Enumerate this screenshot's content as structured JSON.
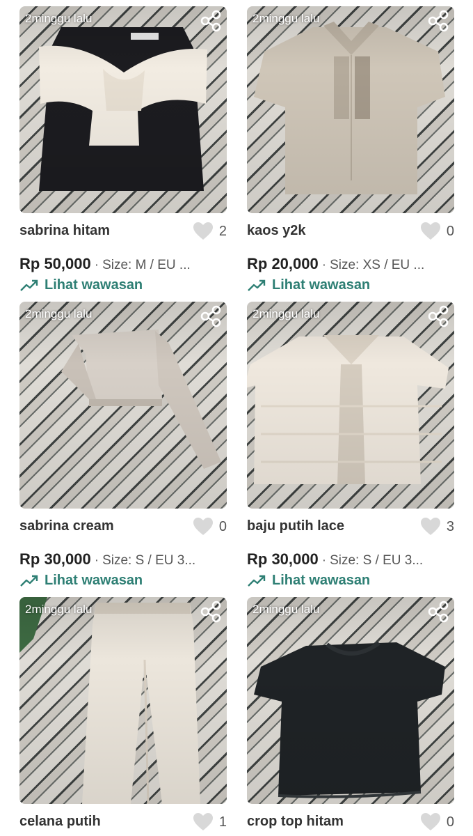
{
  "colors": {
    "insight": "#2e7f74",
    "title": "#333333",
    "heart": "#d8d8d8"
  },
  "products": [
    {
      "posted": "2minggu lalu",
      "title": "sabrina hitam",
      "likes": "2",
      "price": "Rp 50,000",
      "size": "Size: M / EU ...",
      "insight_label": "Lihat wawasan",
      "icons": [
        "share-icon",
        "heart-icon",
        "trend-up-icon"
      ]
    },
    {
      "posted": "2minggu lalu",
      "title": "kaos y2k",
      "likes": "0",
      "price": "Rp 20,000",
      "size": "Size: XS / EU ...",
      "insight_label": "Lihat wawasan",
      "icons": [
        "share-icon",
        "heart-icon",
        "trend-up-icon"
      ]
    },
    {
      "posted": "2minggu lalu",
      "title": "sabrina cream",
      "likes": "0",
      "price": "Rp 30,000",
      "size": "Size: S / EU 3...",
      "insight_label": "Lihat wawasan",
      "icons": [
        "share-icon",
        "heart-icon",
        "trend-up-icon"
      ]
    },
    {
      "posted": "2minggu lalu",
      "title": "baju putih lace",
      "likes": "3",
      "price": "Rp 30,000",
      "size": "Size: S / EU 3...",
      "insight_label": "Lihat wawasan",
      "icons": [
        "share-icon",
        "heart-icon",
        "trend-up-icon"
      ]
    },
    {
      "posted": "2minggu lalu",
      "title": "celana putih",
      "likes": "1",
      "icons": [
        "share-icon",
        "heart-icon"
      ]
    },
    {
      "posted": "2minggu lalu",
      "title": "crop top hitam",
      "likes": "0",
      "icons": [
        "share-icon",
        "heart-icon"
      ]
    }
  ]
}
